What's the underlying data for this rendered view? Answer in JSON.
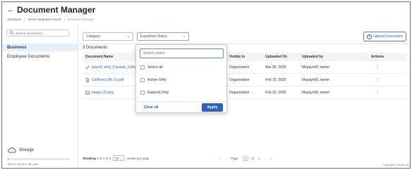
{
  "header": {
    "title": "Document Manager",
    "breadcrumbs": [
      "Employee",
      "Zenoti Integrated Payroll",
      "Document Manager"
    ]
  },
  "sidebar": {
    "search_placeholder": "Search documents...",
    "items": [
      {
        "label": "Business",
        "active": true
      },
      {
        "label": "Employee Documents",
        "active": false
      }
    ],
    "storage": {
      "label": "Storage",
      "usage_text": "955.12 KB of 5 GB used",
      "used_fraction": 0.0002
    }
  },
  "toolbar": {
    "category_label": "Category",
    "expiration_label": "Expiration Status",
    "upload_label": "Upload Document"
  },
  "documents": {
    "count_label": "3 Documents",
    "columns": [
      "Document Name",
      "Visible to",
      "Uploaded On",
      "Uploaded by",
      "Actions"
    ],
    "rows": [
      {
        "icon": "link-icon",
        "name": "payroll_emp_Paystub_21Aug",
        "visible_to": "Organization",
        "uploaded_on": "Mar 06, 2026",
        "uploaded_by": "Mspayroll1 owner"
      },
      {
        "icon": "document-icon",
        "name": "California DE (1).pdf",
        "visible_to": "Organization",
        "uploaded_on": "Feb 19, 2026",
        "uploaded_by": "Mspayroll1 owner"
      },
      {
        "icon": "image-icon",
        "name": "image (2).png",
        "visible_to": "Organization",
        "uploaded_on": "Feb 19, 2026",
        "uploaded_by": "Mspayroll1 owner"
      }
    ]
  },
  "pagination": {
    "showing_label": "Showing",
    "from": "1",
    "to_label": "to",
    "to": "3",
    "of_label": "of",
    "total": "3",
    "per_page": "20",
    "per_page_label": "results per page",
    "page_label": "Page",
    "page": "1",
    "page_of": "of",
    "page_total": "1"
  },
  "expiration_dropdown": {
    "search_placeholder": "Search status",
    "options": [
      "Select all",
      "Active Only",
      "Expired Only"
    ],
    "clear_label": "Clear all",
    "apply_label": "Apply"
  },
  "footer": {
    "copyright": "Copyright © Zenoti.com"
  },
  "colors": {
    "accent": "#2f62b5",
    "active_bg": "#e6f0fb"
  }
}
